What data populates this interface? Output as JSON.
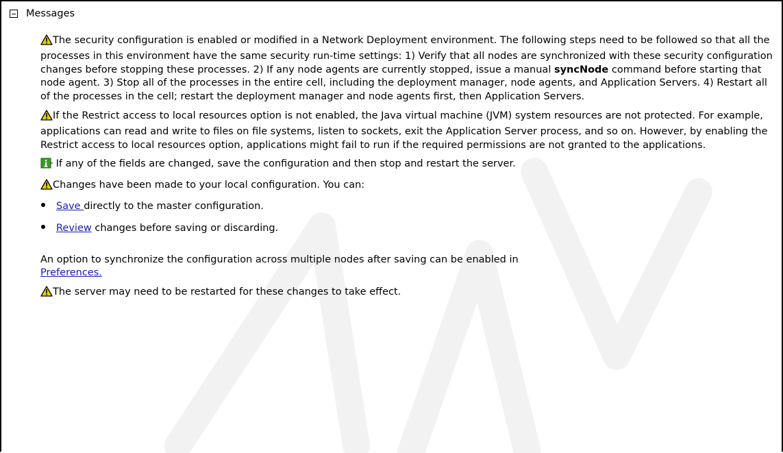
{
  "section": {
    "title": "Messages"
  },
  "messages": [
    {
      "type": "warning",
      "text": "The security configuration is enabled or modified in a Network Deployment environment. The following steps need to be followed so that all the processes in this environment have the same security run-time settings: 1) Verify that all nodes are synchronized with these security configuration changes before stopping these processes. 2) If any node agents are currently stopped, issue a manual ",
      "bold": "syncNode",
      "text_after": " command before starting that node agent. 3) Stop all of the processes in the entire cell, including the deployment manager, node agents, and Application Servers. 4) Restart all of the processes in the cell; restart the deployment manager and node agents first, then Application Servers."
    },
    {
      "type": "warning",
      "text": "If the Restrict access to local resources option is not enabled, the Java virtual machine (JVM) system resources are not protected. For example, applications can read and write to files on file systems, listen to sockets, exit the Application Server process, and so on. However, by enabling the Restrict access to local resources option, applications might fail to run if the required permissions are not granted to the applications."
    },
    {
      "type": "info",
      "text": " If any of the fields are changed, save the configuration and then stop and restart the server."
    },
    {
      "type": "warning",
      "text": "Changes have been made to your local configuration. You can:"
    }
  ],
  "actions": [
    {
      "link": "Save ",
      "text": "directly to the master configuration."
    },
    {
      "link": "Review",
      "text": " changes before saving or discarding."
    }
  ],
  "sync_note": {
    "text": "An option to synchronize the configuration across multiple nodes after saving can be enabled in ",
    "link": "Preferences."
  },
  "final_message": {
    "type": "warning",
    "text": "The server may need to be restarted for these changes to take effect."
  },
  "colors": {
    "link": "#1a1ab8",
    "warning_fill": "#e8d000",
    "info_fill": "#3a9a2a"
  },
  "icons": {
    "collapse": "collapse-box-icon",
    "warning": "warning-triangle-icon",
    "info": "info-icon",
    "bullet": "bullet-icon"
  }
}
